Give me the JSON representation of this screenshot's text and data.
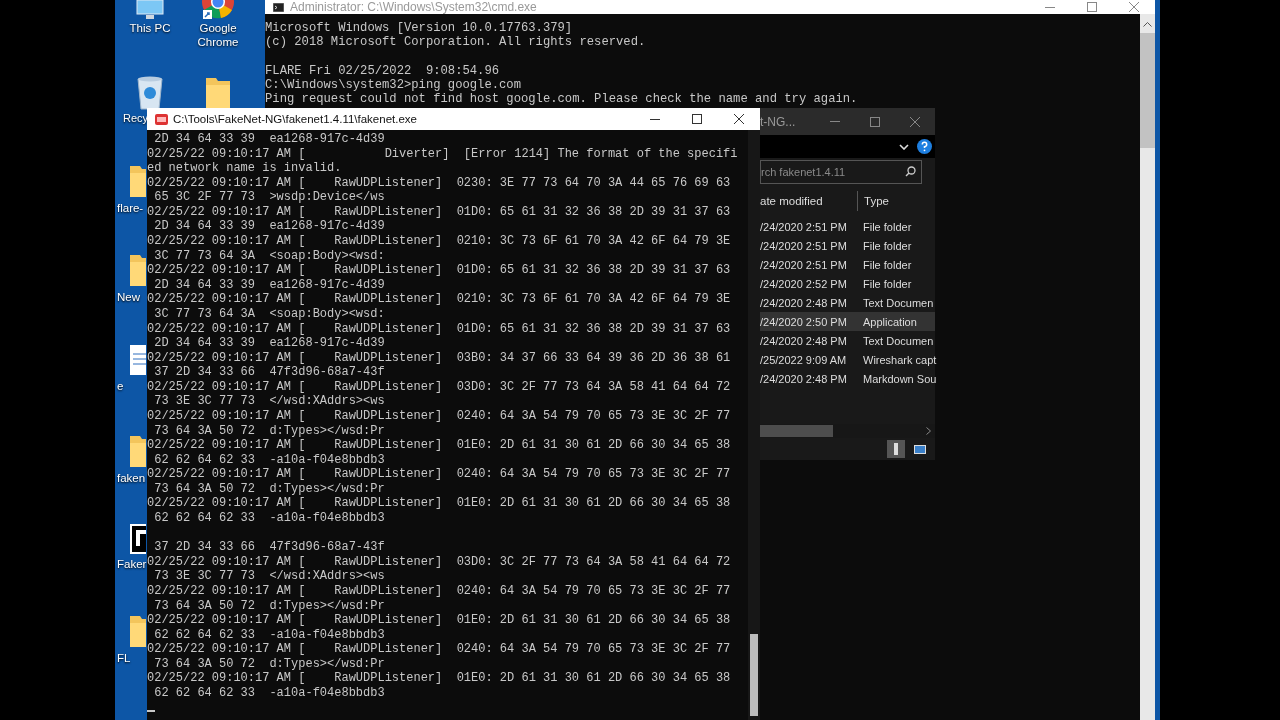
{
  "desktop": {
    "top_icons": [
      {
        "label": "This PC",
        "kind": "pc"
      },
      {
        "label": "Google Chrome",
        "kind": "chrome"
      },
      {
        "label": "Recy",
        "kind": "recycle"
      },
      {
        "kind": "folder"
      }
    ],
    "side_icons": [
      {
        "label": "flare-",
        "kind": "folder"
      },
      {
        "label": "New",
        "kind": "folder"
      },
      {
        "label": "e",
        "kind": "document"
      },
      {
        "label": "faken",
        "kind": "folder"
      },
      {
        "label": "Faker",
        "kind": "app"
      },
      {
        "label": "FL",
        "kind": "folder"
      }
    ]
  },
  "cmd_window": {
    "title": "Administrator: C:\\Windows\\System32\\cmd.exe",
    "blocks": [
      [
        "Microsoft Windows [Version 10.0.17763.379]",
        "(c) 2018 Microsoft Corporation. All rights reserved."
      ],
      [
        "FLARE Fri 02/25/2022  9:08:54.96",
        "C:\\Windows\\system32>ping google.com",
        "Ping request could not find host google.com. Please check the name and try again."
      ]
    ]
  },
  "explorer_window": {
    "title": "t-NG...",
    "search": {
      "placeholder": "rch fakenet1.4.11"
    },
    "columns": [
      "ate modified",
      "Type"
    ],
    "rows": [
      {
        "date": "/24/2020 2:51 PM",
        "type": "File folder",
        "selected": false
      },
      {
        "date": "/24/2020 2:51 PM",
        "type": "File folder",
        "selected": false
      },
      {
        "date": "/24/2020 2:51 PM",
        "type": "File folder",
        "selected": false
      },
      {
        "date": "/24/2020 2:52 PM",
        "type": "File folder",
        "selected": false
      },
      {
        "date": "/24/2020 2:48 PM",
        "type": "Text Documen",
        "selected": false
      },
      {
        "date": "/24/2020 2:50 PM",
        "type": "Application",
        "selected": true
      },
      {
        "date": "/24/2020 2:48 PM",
        "type": "Text Documen",
        "selected": false
      },
      {
        "date": "/25/2022 9:09 AM",
        "type": "Wireshark capt",
        "selected": false
      },
      {
        "date": "/24/2020 2:48 PM",
        "type": "Markdown Sou",
        "selected": false
      }
    ]
  },
  "fakenet_window": {
    "title": "C:\\Tools\\FakeNet-NG\\fakenet1.4.11\\fakenet.exe",
    "blocks": [
      [
        " 2D 34 64 33 39  ea1268-917c-4d39",
        "02/25/22 09:10:17 AM [           Diverter]  [Error 1214] The format of the specifi",
        "ed network name is invalid.",
        "02/25/22 09:10:17 AM [    RawUDPListener]  0230: 3E 77 73 64 70 3A 44 65 76 69 63",
        " 65 3C 2F 77 73  >wsdp:Device</ws",
        "02/25/22 09:10:17 AM [    RawUDPListener]  01D0: 65 61 31 32 36 38 2D 39 31 37 63",
        " 2D 34 64 33 39  ea1268-917c-4d39",
        "02/25/22 09:10:17 AM [    RawUDPListener]  0210: 3C 73 6F 61 70 3A 42 6F 64 79 3E",
        " 3C 77 73 64 3A  <soap:Body><wsd:",
        "02/25/22 09:10:17 AM [    RawUDPListener]  01D0: 65 61 31 32 36 38 2D 39 31 37 63",
        " 2D 34 64 33 39  ea1268-917c-4d39",
        "02/25/22 09:10:17 AM [    RawUDPListener]  0210: 3C 73 6F 61 70 3A 42 6F 64 79 3E",
        " 3C 77 73 64 3A  <soap:Body><wsd:",
        "02/25/22 09:10:17 AM [    RawUDPListener]  01D0: 65 61 31 32 36 38 2D 39 31 37 63",
        " 2D 34 64 33 39  ea1268-917c-4d39",
        "02/25/22 09:10:17 AM [    RawUDPListener]  03B0: 34 37 66 33 64 39 36 2D 36 38 61",
        " 37 2D 34 33 66  47f3d96-68a7-43f",
        "02/25/22 09:10:17 AM [    RawUDPListener]  03D0: 3C 2F 77 73 64 3A 58 41 64 64 72",
        " 73 3E 3C 77 73  </wsd:XAddrs><ws",
        "02/25/22 09:10:17 AM [    RawUDPListener]  0240: 64 3A 54 79 70 65 73 3E 3C 2F 77",
        " 73 64 3A 50 72  d:Types></wsd:Pr",
        "02/25/22 09:10:17 AM [    RawUDPListener]  01E0: 2D 61 31 30 61 2D 66 30 34 65 38",
        " 62 62 64 62 33  -a10a-f04e8bbdb3",
        "02/25/22 09:10:17 AM [    RawUDPListener]  0240: 64 3A 54 79 70 65 73 3E 3C 2F 77",
        " 73 64 3A 50 72  d:Types></wsd:Pr",
        "02/25/22 09:10:17 AM [    RawUDPListener]  01E0: 2D 61 31 30 61 2D 66 30 34 65 38",
        " 62 62 64 62 33  -a10a-f04e8bbdb3"
      ],
      [
        " 37 2D 34 33 66  47f3d96-68a7-43f",
        "02/25/22 09:10:17 AM [    RawUDPListener]  03D0: 3C 2F 77 73 64 3A 58 41 64 64 72",
        " 73 3E 3C 77 73  </wsd:XAddrs><ws",
        "02/25/22 09:10:17 AM [    RawUDPListener]  0240: 64 3A 54 79 70 65 73 3E 3C 2F 77",
        " 73 64 3A 50 72  d:Types></wsd:Pr",
        "02/25/22 09:10:17 AM [    RawUDPListener]  01E0: 2D 61 31 30 61 2D 66 30 34 65 38",
        " 62 62 64 62 33  -a10a-f04e8bbdb3",
        "02/25/22 09:10:17 AM [    RawUDPListener]  0240: 64 3A 54 79 70 65 73 3E 3C 2F 77",
        " 73 64 3A 50 72  d:Types></wsd:Pr",
        "02/25/22 09:10:17 AM [    RawUDPListener]  01E0: 2D 61 31 30 61 2D 66 30 34 65 38",
        " 62 62 64 62 33  -a10a-f04e8bbdb3"
      ]
    ]
  }
}
